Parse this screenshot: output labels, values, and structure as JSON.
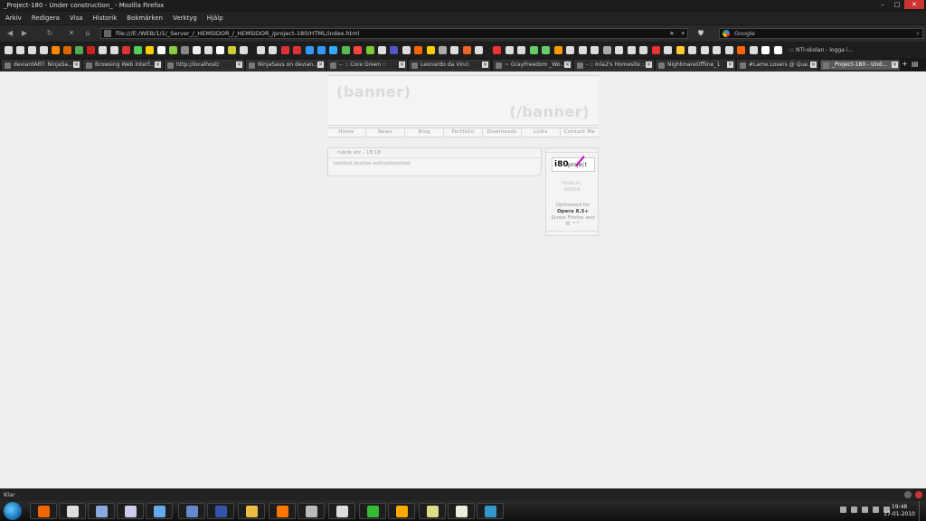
{
  "window": {
    "title": "_Project-180 - Under construction_ - Mozilla Firefox",
    "min": "–",
    "max": "□",
    "close": "✕"
  },
  "menu": [
    "Arkiv",
    "Redigera",
    "Visa",
    "Historik",
    "Bokmärken",
    "Verktyg",
    "Hjälp"
  ],
  "nav": {
    "back": "◀",
    "forward": "▶",
    "reload": "↻",
    "stop": "✕",
    "home": "⌂",
    "url": "file:///E:/WEB/1/1/_Server_/_HEMSIDOR_/_HEMSIDOR_/project-180/HTML/index.html",
    "star": "★",
    "dropdown": "▾",
    "search_placeholder": "Google",
    "search_icon": "⌕"
  },
  "bookmarks": {
    "last_label": "::: NTI-skolan - logga i...",
    "icon_colors": [
      "#ddd",
      "#ddd",
      "#ddd",
      "#ddd",
      "#f80",
      "#d60",
      "#5a5",
      "#c22",
      "#ddd",
      "#ddd",
      "#d33",
      "#5c5",
      "#fc0",
      "#fff",
      "#8c4",
      "#888",
      "#eee",
      "#ddd",
      "#fff",
      "#cc3",
      "#ddd",
      "#ddd",
      "#ddd",
      "#d33",
      "#d33",
      "#39f",
      "#39f",
      "#3af",
      "#5b5",
      "#f44",
      "#7c3",
      "#ddd",
      "#55c",
      "#ddd",
      "#f60",
      "#fc0",
      "#aaa",
      "#ddd",
      "#e62",
      "#ddd",
      "#e33",
      "#ddd",
      "#ddd",
      "#6c6",
      "#6c6",
      "#f90",
      "#ddd",
      "#ddd",
      "#ddd",
      "#aaa",
      "#ddd",
      "#ddd",
      "#ddd",
      "#e33",
      "#ddd",
      "#fc3",
      "#ddd",
      "#ddd",
      "#ddd",
      "#ddd",
      "#f60",
      "#ddd",
      "#fff",
      "#fff"
    ]
  },
  "tabs": [
    {
      "label": "deviantART: NinjaSa...",
      "active": false
    },
    {
      "label": "Browsing Web Interf...",
      "active": false
    },
    {
      "label": "http://localhost/",
      "active": false
    },
    {
      "label": "NinjaSaus on devian...",
      "active": false
    },
    {
      "label": "-- :: Core Green ::",
      "active": false
    },
    {
      "label": "Leonardo da Vinci",
      "active": false
    },
    {
      "label": "~ GrayFreedom _Wo...",
      "active": false
    },
    {
      "label": "- :: Inla2's Homesite :...",
      "active": false
    },
    {
      "label": "NightmareOffline_1",
      "active": false
    },
    {
      "label": "#Lame.Losers @ Qua...",
      "active": false
    },
    {
      "label": "_Project-180 - Und...",
      "active": true
    }
  ],
  "tab_controls": {
    "new": "+",
    "list": "▤"
  },
  "page": {
    "banner_left": "(banner)",
    "banner_right": "(/banner)",
    "nav_links": [
      "Home",
      "News",
      "Blog",
      "Portfolio",
      "Downloads",
      "Links",
      "Contact Me"
    ],
    "post": {
      "header": "rubrik etc - 18:18",
      "body": "testtest testtes esthesttesttest"
    },
    "side": {
      "logo_number": "i80",
      "logo_text": "project",
      "visitors_label": "Visitors:",
      "visitors_count": "00059",
      "optimized_prefix": "Optimized for",
      "optimized_browser": "Opera 8.5+",
      "optimized_suffix": "Screw Firefox and IE ^^"
    }
  },
  "status": {
    "text": "Klar"
  },
  "taskbar": {
    "icons": [
      "#e60",
      "#ddd",
      "#8ad",
      "#cce",
      "#6ae",
      "#68c",
      "#35a",
      "#eb4",
      "#f70",
      "#bbb",
      "#ddd",
      "#3b3",
      "#fa0",
      "#dd8",
      "#eed",
      "#39c"
    ],
    "time": "19:48",
    "date": "17-01-2010"
  }
}
